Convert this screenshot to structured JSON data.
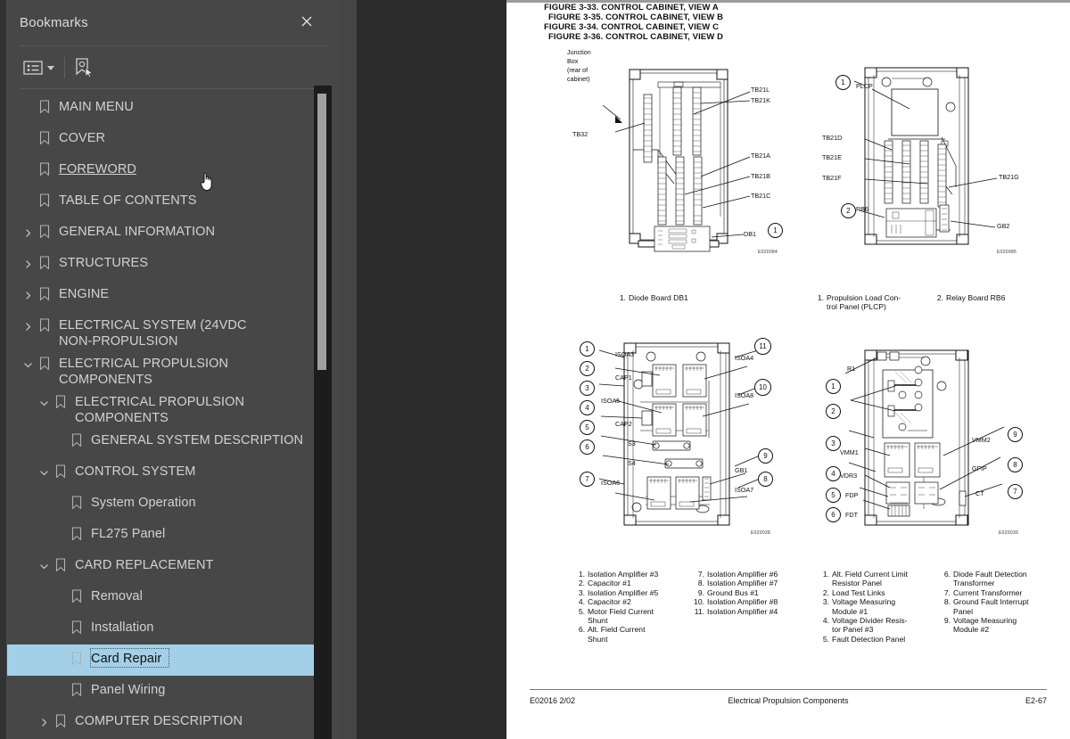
{
  "panel": {
    "title": "Bookmarks",
    "close_icon": "close-icon",
    "toolbar": {
      "options_label": "bookmark-options",
      "caret_icon": "chevron-down-icon",
      "new_bookmark_label": "new-bookmark"
    }
  },
  "bookmarks": [
    {
      "label": "MAIN MENU",
      "level": 0,
      "twisty": "none",
      "state": "normal"
    },
    {
      "label": "COVER",
      "level": 0,
      "twisty": "none",
      "state": "normal"
    },
    {
      "label": "FOREWORD",
      "level": 0,
      "twisty": "none",
      "state": "hover"
    },
    {
      "label": "TABLE OF CONTENTS",
      "level": 0,
      "twisty": "none",
      "state": "normal"
    },
    {
      "label": "GENERAL INFORMATION",
      "level": 0,
      "twisty": "collapsed",
      "state": "normal"
    },
    {
      "label": "STRUCTURES",
      "level": 0,
      "twisty": "collapsed",
      "state": "normal"
    },
    {
      "label": "ENGINE",
      "level": 0,
      "twisty": "collapsed",
      "state": "normal"
    },
    {
      "label": "ELECTRICAL SYSTEM (24VDC\nNON-PROPULSION",
      "level": 0,
      "twisty": "collapsed",
      "state": "normal"
    },
    {
      "label": "ELECTRICAL PROPULSION\nCOMPONENTS",
      "level": 0,
      "twisty": "expanded",
      "state": "normal"
    },
    {
      "label": "ELECTRICAL PROPULSION\nCOMPONENTS",
      "level": 1,
      "twisty": "expanded",
      "state": "normal"
    },
    {
      "label": "GENERAL SYSTEM DESCRIPTION",
      "level": 2,
      "twisty": "none",
      "state": "normal"
    },
    {
      "label": "CONTROL SYSTEM",
      "level": 1,
      "twisty": "expanded",
      "state": "normal"
    },
    {
      "label": "System Operation",
      "level": 2,
      "twisty": "none",
      "state": "normal"
    },
    {
      "label": "FL275 Panel",
      "level": 2,
      "twisty": "none",
      "state": "normal"
    },
    {
      "label": "CARD REPLACEMENT",
      "level": 1,
      "twisty": "expanded",
      "state": "normal"
    },
    {
      "label": "Removal",
      "level": 2,
      "twisty": "none",
      "state": "normal"
    },
    {
      "label": "Installation",
      "level": 2,
      "twisty": "none",
      "state": "normal"
    },
    {
      "label": "Card Repair",
      "level": 2,
      "twisty": "none",
      "state": "selected"
    },
    {
      "label": "Panel Wiring",
      "level": 2,
      "twisty": "none",
      "state": "normal"
    },
    {
      "label": "COMPUTER DESCRIPTION",
      "level": 1,
      "twisty": "collapsed",
      "state": "normal"
    }
  ],
  "document": {
    "figures": [
      {
        "caption": "FIGURE 3-33. CONTROL CABINET, VIEW A",
        "diagram_id": "E020084",
        "diagram_labels": [
          "Junction",
          "Box",
          "(rear of",
          "cabinet)",
          "TB32",
          "TB21L",
          "TB21K",
          "TB21A",
          "TB21B",
          "TB21C",
          "DB1"
        ],
        "callouts": [
          "1"
        ],
        "legend": [
          {
            "num": "1.",
            "txt": "Diode Board DB1"
          }
        ]
      },
      {
        "caption": "FIGURE 3-35. CONTROL CABINET, VIEW B",
        "diagram_id": "E020085",
        "diagram_labels": [
          "PLCP",
          "TB21D",
          "TB21E",
          "TB21F",
          "TB21G",
          "RB6",
          "GB2"
        ],
        "callouts": [
          "1",
          "2"
        ],
        "legend": [
          {
            "num": "1.",
            "txt": "Propulsion Load Con-\ntrol Panel (PLCP)"
          },
          {
            "num": "2.",
            "txt": "Relay Board RB6"
          }
        ]
      },
      {
        "caption": "FIGURE 3-34. CONTROL CABINET, VIEW C",
        "diagram_id": "E020028",
        "diagram_labels": [
          "ISOA3",
          "CAP1",
          "ISOA5",
          "CAP2",
          "S3",
          "S4",
          "ISOA6",
          "ISOA4",
          "ISOA8",
          "GB1",
          "ISOA7"
        ],
        "callouts": [
          "1",
          "2",
          "3",
          "4",
          "5",
          "6",
          "7",
          "8",
          "9",
          "10",
          "11"
        ],
        "legend": [
          {
            "num": "1.",
            "txt": "Isolation Amplifier #3"
          },
          {
            "num": "2.",
            "txt": "Capacitor #1"
          },
          {
            "num": "3.",
            "txt": "Isolation Amplifier #5"
          },
          {
            "num": "4.",
            "txt": "Capacitor #2"
          },
          {
            "num": "5.",
            "txt": "Motor Field Current\n   Shunt"
          },
          {
            "num": "6.",
            "txt": "Alt. Field Current\n   Shunt"
          },
          {
            "num": "7.",
            "txt": "Isolation Amplifier #6"
          },
          {
            "num": "8.",
            "txt": "Isolation Amplifier #7"
          },
          {
            "num": "9.",
            "txt": "Ground Bus #1"
          },
          {
            "num": "10.",
            "txt": "Isolation Amplifier #8"
          },
          {
            "num": "11.",
            "txt": "Isolation Amplifier #4"
          }
        ]
      },
      {
        "caption": "FIGURE 3-36. CONTROL CABINET, VIEW D",
        "diagram_id": "E020039",
        "diagram_labels": [
          "R1",
          "VMM1",
          "VDR3",
          "FDP",
          "FDT",
          "VMM2",
          "GFIP",
          "CT"
        ],
        "callouts": [
          "1",
          "2",
          "3",
          "4",
          "5",
          "6",
          "7",
          "8",
          "9"
        ],
        "legend": [
          {
            "num": "1.",
            "txt": "Alt. Field Current Limit\n   Resistor Panel"
          },
          {
            "num": "2.",
            "txt": "Load Test Links"
          },
          {
            "num": "3.",
            "txt": "Voltage Measuring\n   Module #1"
          },
          {
            "num": "4.",
            "txt": "Voltage Divider Resis-\n   tor Panel #3"
          },
          {
            "num": "5.",
            "txt": "Fault Detection Panel"
          },
          {
            "num": "6.",
            "txt": "Diode Fault Detection\n   Transformer"
          },
          {
            "num": "7.",
            "txt": "Current Transformer"
          },
          {
            "num": "8.",
            "txt": "Ground Fault Interrupt\n   Panel"
          },
          {
            "num": "9.",
            "txt": "Voltage Measuring\n   Module #2"
          }
        ]
      }
    ],
    "footer": {
      "left": "E02016 2/02",
      "center": "Electrical Propulsion Components",
      "right": "E2-67"
    }
  },
  "colors": {
    "panel_bg": "#474747",
    "rail_bg": "#333333",
    "viewer_bg": "#2b2b2b",
    "selection": "#a4cfe8",
    "text": "#d2d2d2",
    "page_bg": "#ffffff"
  }
}
